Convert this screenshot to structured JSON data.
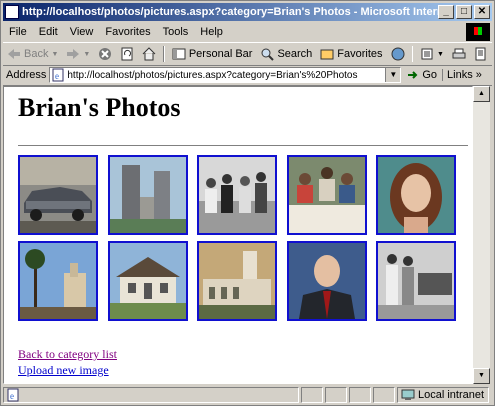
{
  "window": {
    "title": "http://localhost/photos/pictures.aspx?category=Brian's Photos - Microsoft Internet Explorer",
    "minimize": "_",
    "maximize": "□",
    "close": "✕"
  },
  "menu": [
    "File",
    "Edit",
    "View",
    "Favorites",
    "Tools",
    "Help"
  ],
  "toolbar": {
    "back": "Back",
    "personal_bar": "Personal Bar",
    "search": "Search",
    "favorites": "Favorites"
  },
  "address": {
    "label": "Address",
    "url": "http://localhost/photos/pictures.aspx?category=Brian's%20Photos",
    "go": "Go",
    "links": "Links"
  },
  "page": {
    "title": "Brian's Photos",
    "thumbnails": [
      {
        "name": "vintage car"
      },
      {
        "name": "city towers"
      },
      {
        "name": "group photo"
      },
      {
        "name": "family dinner"
      },
      {
        "name": "portrait woman"
      },
      {
        "name": "mission palm trees"
      },
      {
        "name": "historic house"
      },
      {
        "name": "mission church"
      },
      {
        "name": "portrait man"
      },
      {
        "name": "men by car"
      }
    ],
    "back_link": "Back to category list",
    "upload_link": "Upload new image"
  },
  "status": {
    "zone": "Local intranet"
  },
  "colors": {
    "thumb_border": "#1010d0",
    "visited_link": "#800080",
    "link": "#0000cc"
  }
}
